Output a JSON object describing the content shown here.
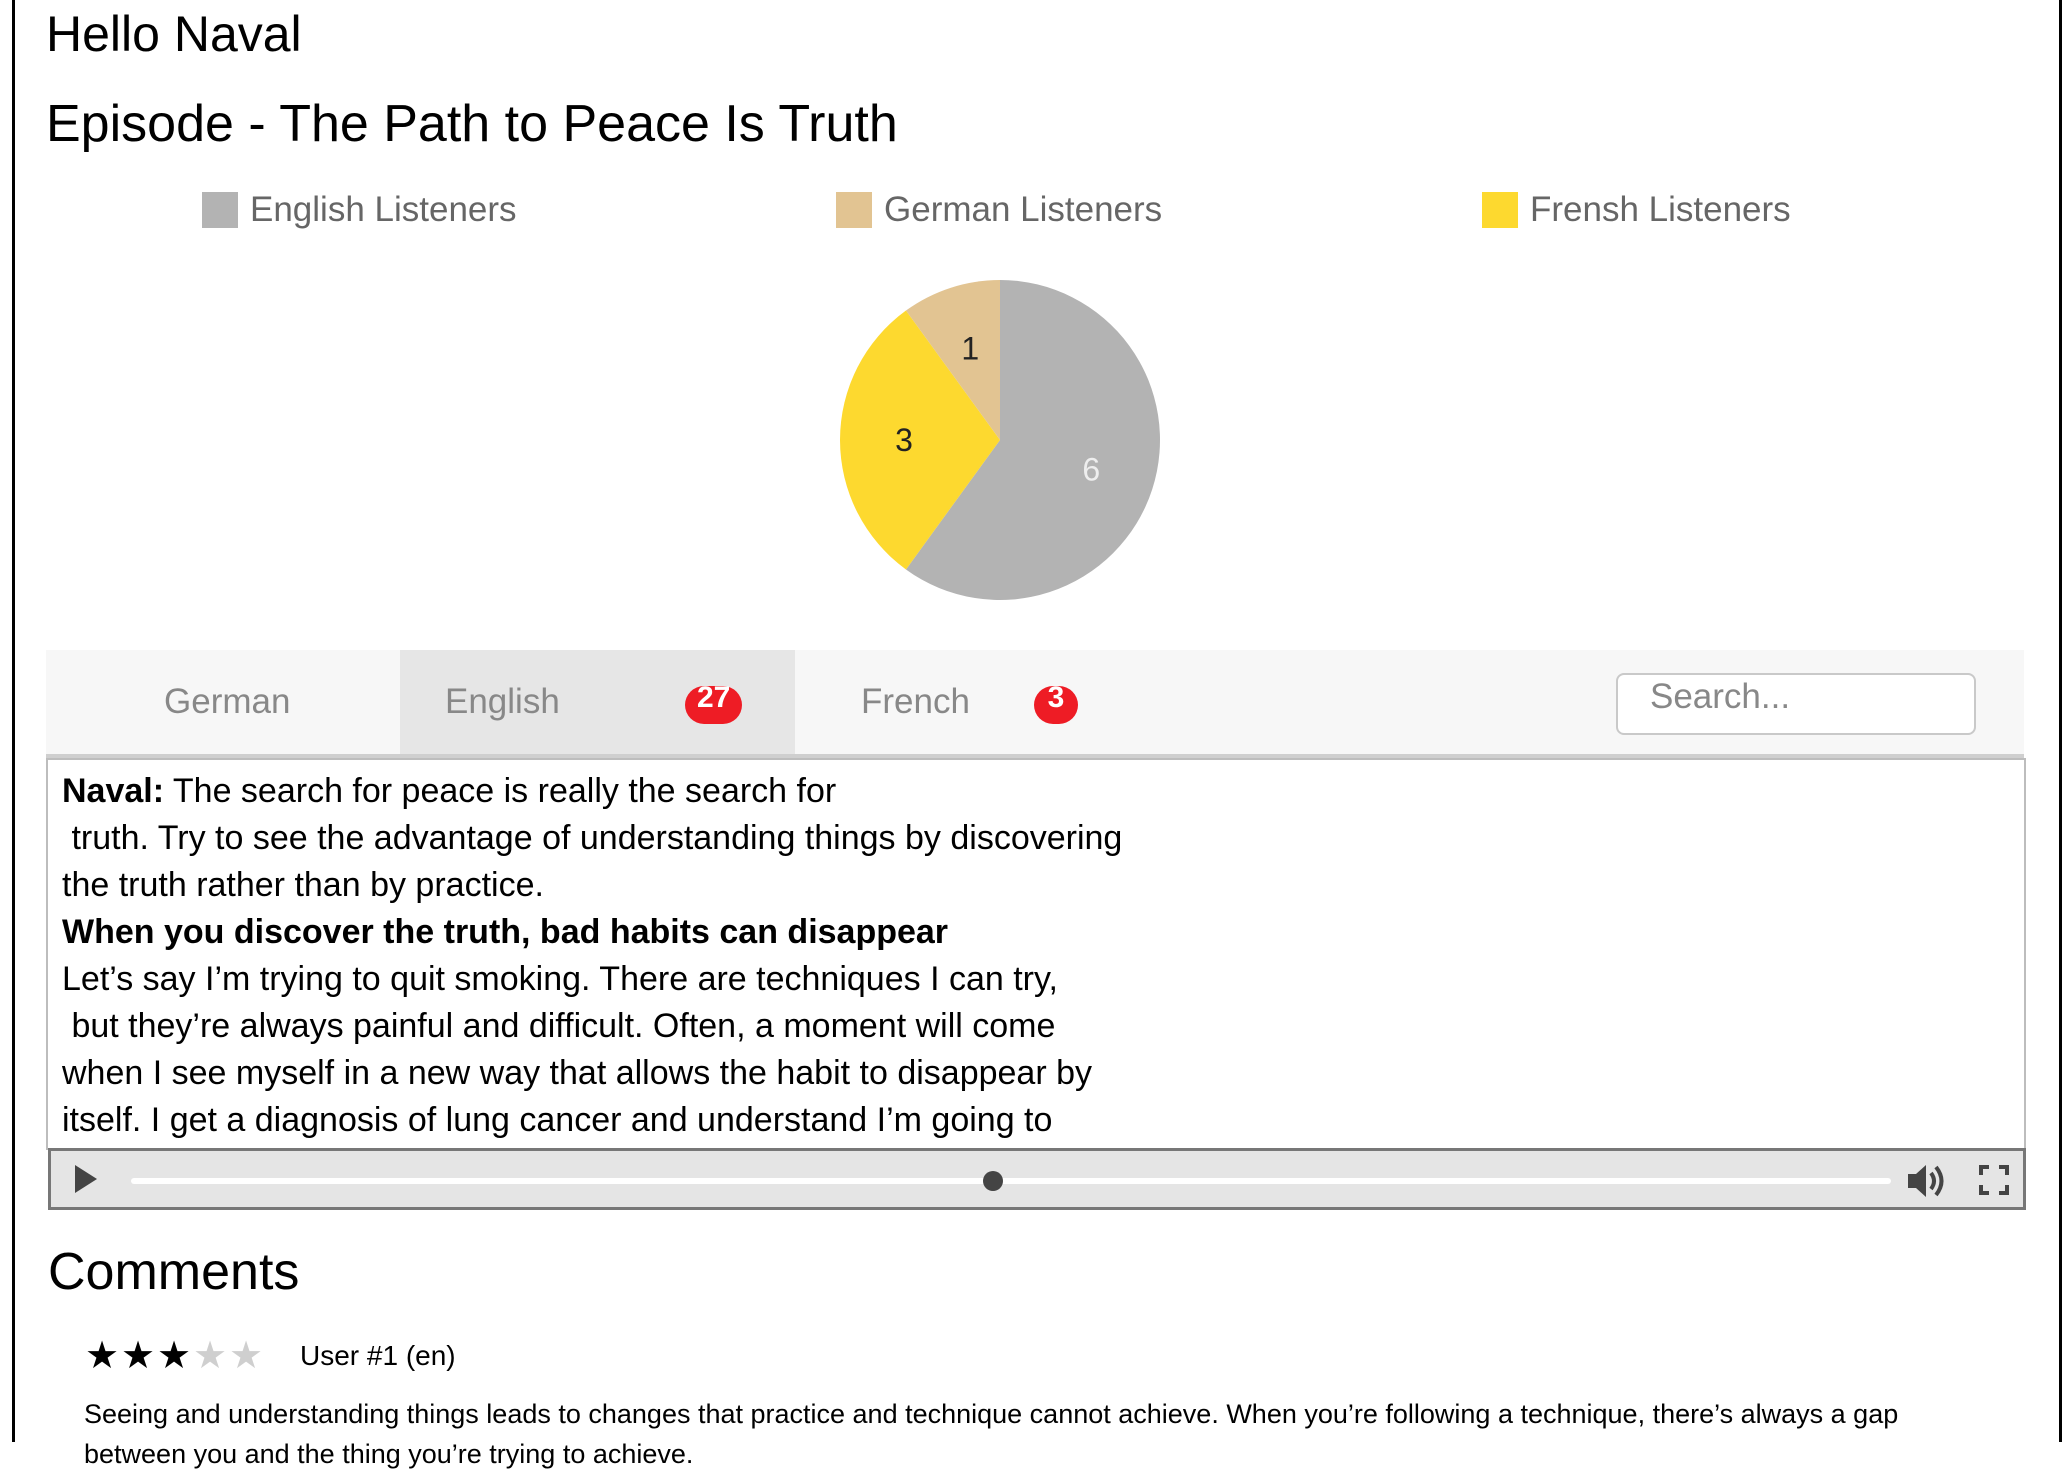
{
  "greeting": "Hello Naval",
  "episode_title": "Episode - The Path to Peace Is Truth",
  "colors": {
    "english": "#b3b3b3",
    "german": "#e2c492",
    "french": "#fdd92f",
    "badge": "#ee1c25",
    "active_tab": "#e6e6e6",
    "tabbar": "#f7f7f7"
  },
  "legend": [
    {
      "label": "English Listeners",
      "color": "#b3b3b3"
    },
    {
      "label": "German Listeners",
      "color": "#e2c492"
    },
    {
      "label": "Frensh Listeners",
      "color": "#fdd92f"
    }
  ],
  "chart_data": {
    "type": "pie",
    "title": "",
    "categories": [
      "English Listeners",
      "German Listeners",
      "Frensh Listeners"
    ],
    "slices": [
      {
        "label": "English Listeners",
        "value": 6,
        "color": "#b3b3b3",
        "label_color": "#eeeeee"
      },
      {
        "label": "Frensh Listeners",
        "value": 3,
        "color": "#fdd92f",
        "label_color": "#222222"
      },
      {
        "label": "German Listeners",
        "value": 1,
        "color": "#e2c492",
        "label_color": "#222222"
      }
    ],
    "legend_position": "top",
    "start_angle": "top, clockwise"
  },
  "tabs": [
    {
      "label": "German",
      "badge": null,
      "active": false
    },
    {
      "label": "English",
      "badge": "27",
      "active": true
    },
    {
      "label": "French",
      "badge": "3",
      "active": false
    }
  ],
  "search": {
    "placeholder": "Search...",
    "value": ""
  },
  "transcript": {
    "speaker": "Naval:",
    "lines": [
      " The search for peace is really the search for",
      " truth. Try to see the advantage of understanding things by discovering",
      "the truth rather than by practice."
    ],
    "heading": "When you discover the truth, bad habits can disappear",
    "lines2": [
      "Let’s say I’m trying to quit smoking. There are techniques I can try,",
      " but they’re always painful and difficult. Often, a moment will come",
      "when I see myself in a new way that allows the habit to disappear by",
      "itself. I get a diagnosis of lung cancer and understand I’m going to"
    ]
  },
  "player": {
    "play_icon": "play-icon",
    "progress": 0.49,
    "volume_icon": "volume-icon",
    "fullscreen_icon": "fullscreen-icon"
  },
  "comments": {
    "heading": "Comments",
    "items": [
      {
        "rating": 3,
        "max_rating": 5,
        "user": "User #1 (en)",
        "text": "Seeing and understanding things leads to changes that practice and technique cannot achieve. When you’re following a technique, there’s always a gap between you and the thing you’re trying to achieve."
      }
    ]
  }
}
